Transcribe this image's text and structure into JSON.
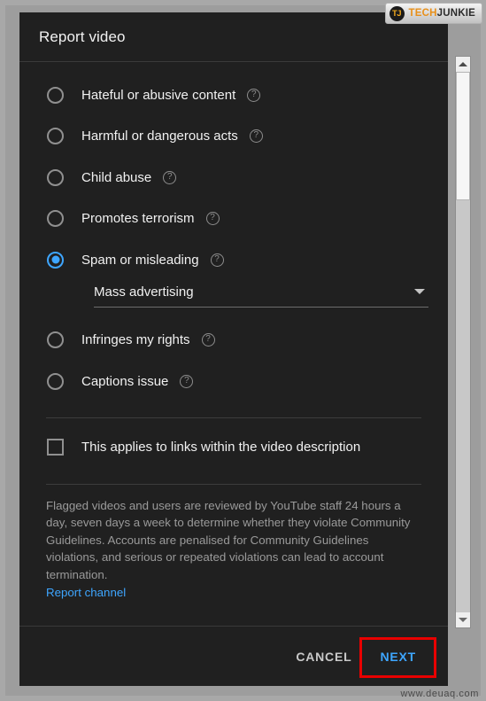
{
  "window": {
    "logo": {
      "mark": "TJ",
      "text_primary": "TECH",
      "text_secondary": "JUNKIE"
    },
    "watermark": "www.deuaq.com"
  },
  "dialog": {
    "title": "Report video",
    "options": [
      {
        "label": "Hateful or abusive content",
        "selected": false,
        "help": "?"
      },
      {
        "label": "Harmful or dangerous acts",
        "selected": false,
        "help": "?"
      },
      {
        "label": "Child abuse",
        "selected": false,
        "help": "?"
      },
      {
        "label": "Promotes terrorism",
        "selected": false,
        "help": "?"
      },
      {
        "label": "Spam or misleading",
        "selected": true,
        "help": "?"
      },
      {
        "label": "Infringes my rights",
        "selected": false,
        "help": "?"
      },
      {
        "label": "Captions issue",
        "selected": false,
        "help": "?"
      }
    ],
    "dropdown": {
      "value": "Mass advertising",
      "icon": "chevron-down-icon"
    },
    "checkbox": {
      "label": "This applies to links within the video description",
      "checked": false
    },
    "disclaimer": {
      "text": "Flagged videos and users are reviewed by YouTube staff 24 hours a day, seven days a week to determine whether they violate Community Guidelines. Accounts are penalised for Community Guidelines violations, and serious or repeated violations can lead to account termination.",
      "link": "Report channel"
    },
    "footer": {
      "cancel_label": "CANCEL",
      "next_label": "NEXT"
    }
  },
  "colors": {
    "dialog_bg": "#202020",
    "accent_blue": "#3ea6ff",
    "highlight_red": "#e80000",
    "text_primary": "#f1f1f1",
    "text_muted": "#9a9a9a",
    "logo_orange": "#e8901a"
  }
}
